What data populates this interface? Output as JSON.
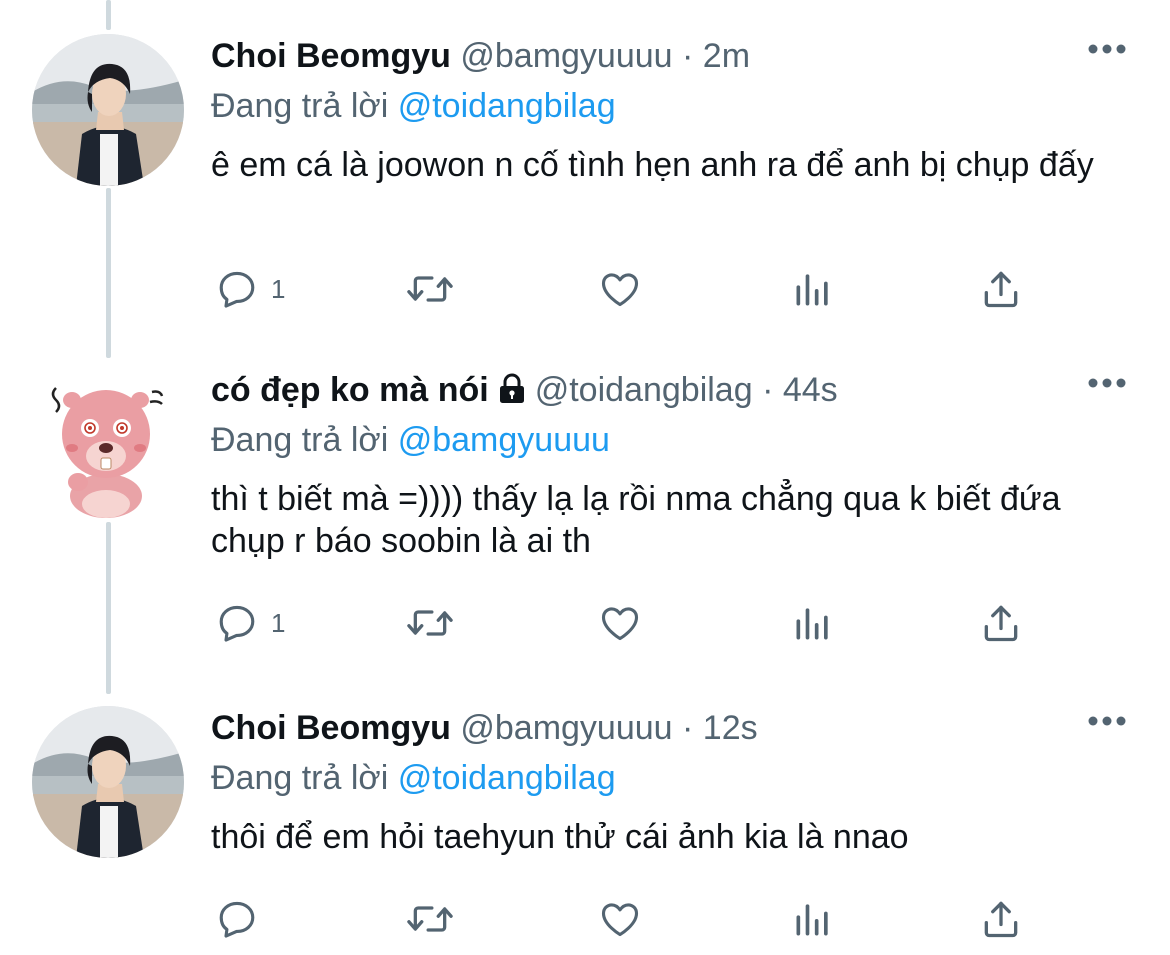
{
  "tweets": [
    {
      "display_name": "Choi Beomgyu",
      "handle": "@bamgyuuuu",
      "dot": "·",
      "time": "2m",
      "locked": false,
      "reply_prefix": "Đang trả lời",
      "reply_to": "@toidangbilag",
      "text": "ê em cá là joowon n cố tình hẹn anh ra để anh bị chụp đấy",
      "reply_count": "1",
      "avatar": "boy-photo"
    },
    {
      "display_name": "có đẹp ko mà nói",
      "handle": "@toidangbilag",
      "dot": "·",
      "time": "44s",
      "locked": true,
      "reply_prefix": "Đang trả lời",
      "reply_to": "@bamgyuuuu",
      "text": "thì t biết mà =)))) thấy lạ lạ rồi nma chẳng qua k biết đứa chụp r báo soobin là ai th",
      "reply_count": "1",
      "avatar": "pink-beaver-sticker"
    },
    {
      "display_name": "Choi Beomgyu",
      "handle": "@bamgyuuuu",
      "dot": "·",
      "time": "12s",
      "locked": false,
      "reply_prefix": "Đang trả lời",
      "reply_to": "@toidangbilag",
      "text": "thôi để em hỏi taehyun thử cái ảnh kia là nnao",
      "reply_count": "",
      "avatar": "boy-photo"
    }
  ],
  "icons": {
    "reply": "reply-icon",
    "retweet": "retweet-icon",
    "like": "like-icon",
    "analytics": "analytics-icon",
    "share": "share-icon",
    "more": "more-icon",
    "lock": "lock-icon"
  },
  "colors": {
    "text": "#0f1419",
    "secondary": "#536471",
    "link": "#1d9bf0",
    "thread_line": "#cfd9de"
  }
}
